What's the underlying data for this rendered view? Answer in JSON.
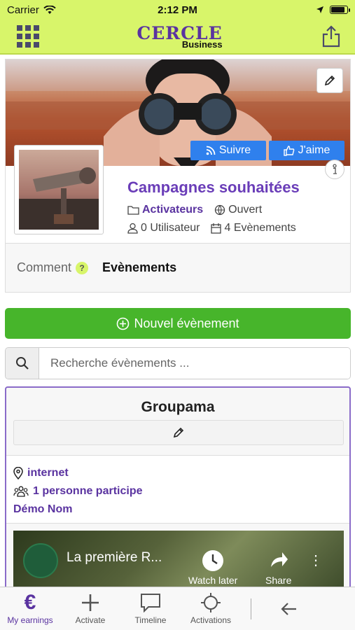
{
  "status_bar": {
    "carrier": "Carrier",
    "time": "2:12 PM"
  },
  "header": {
    "logo_main": "CERCLE",
    "logo_sub": "Business"
  },
  "profile": {
    "follow_label": "Suivre",
    "like_label": "J'aime",
    "title": "Campagnes souhaitées",
    "category": "Activateurs",
    "visibility": "Ouvert",
    "users": "0 Utilisateur",
    "events": "4 Evènements",
    "tabs": {
      "comment": "Comment",
      "comment_help": "?",
      "events": "Evènements"
    }
  },
  "new_event_label": "Nouvel évènement",
  "search": {
    "placeholder": "Recherche évènements ..."
  },
  "event": {
    "title": "Groupama",
    "location": "internet",
    "participants": "1 personne participe",
    "organizer": "Démo Nom",
    "video": {
      "title": "La première R...",
      "watch_later": "Watch later",
      "share": "Share"
    }
  },
  "tab_bar": {
    "items": [
      {
        "label": "My earnings",
        "icon": "euro-icon"
      },
      {
        "label": "Activate",
        "icon": "plus-icon"
      },
      {
        "label": "Timeline",
        "icon": "chat-bubble-icon"
      },
      {
        "label": "Activations",
        "icon": "crosshair-icon"
      }
    ]
  },
  "colors": {
    "accent_lime": "#d8f56a",
    "brand_purple": "#5a33a0",
    "button_blue": "#2f80ed",
    "button_green": "#47b52b"
  }
}
